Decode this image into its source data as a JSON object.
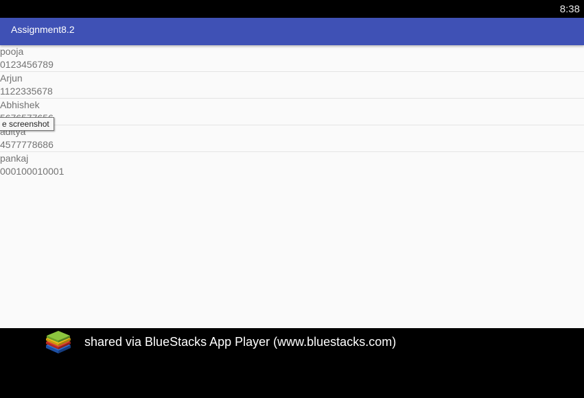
{
  "status_bar": {
    "time": "8:38"
  },
  "app_bar": {
    "title": "Assignment8.2",
    "color": "#3f51b5"
  },
  "contacts": [
    {
      "name": "pooja",
      "phone": "0123456789"
    },
    {
      "name": "Arjun",
      "phone": "1122335678"
    },
    {
      "name": "Abhishek",
      "phone": "5676577656"
    },
    {
      "name": "aditya",
      "phone": "4577778686"
    },
    {
      "name": "pankaj",
      "phone": "000100010001"
    }
  ],
  "tooltip": {
    "text": "e screenshot"
  },
  "footer": {
    "text": "shared via BlueStacks App Player (www.bluestacks.com)",
    "logo_icon": "bluestacks-logo-icon"
  }
}
